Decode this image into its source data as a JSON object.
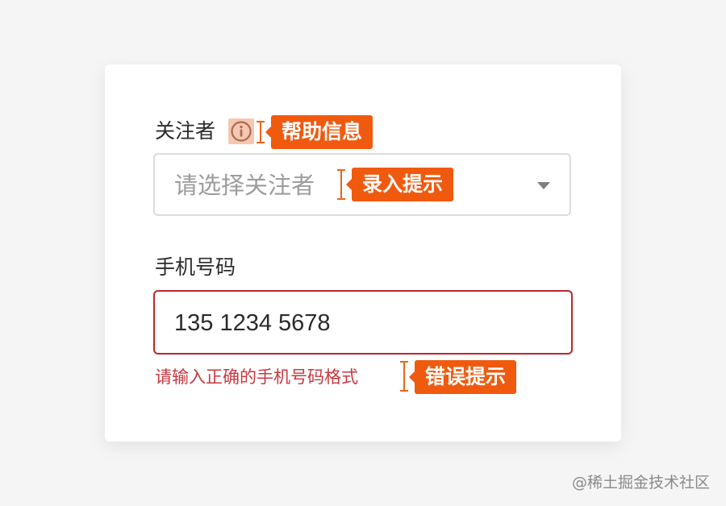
{
  "form": {
    "follower_label": "关注者",
    "follower_placeholder": "请选择关注者",
    "phone_label": "手机号码",
    "phone_value": "135 1234 5678",
    "phone_error": "请输入正确的手机号码格式"
  },
  "annotations": {
    "help": "帮助信息",
    "input_hint": "录入提示",
    "error_hint": "错误提示"
  },
  "icons": {
    "info": "info-circle-icon",
    "dropdown": "caret-down-icon"
  },
  "colors": {
    "annotation": "#f05a0f",
    "error": "#c9373f",
    "error_border": "#c0262a"
  },
  "watermark": "@稀土掘金技术社区"
}
